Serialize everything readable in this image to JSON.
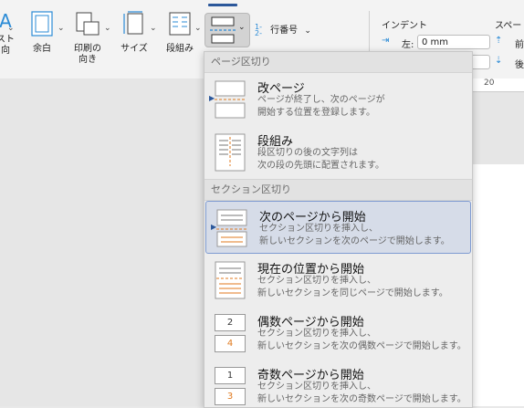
{
  "ribbon": {
    "text_direction_label_line1": "スト",
    "text_direction_label_line2": "向",
    "margins_label": "余白",
    "orientation_label_line1": "印刷の",
    "orientation_label_line2": "向き",
    "size_label": "サイズ",
    "columns_label": "段組み",
    "line_numbers_label": "行番号",
    "indent_header": "インデント",
    "spacing_header": "スペー",
    "indent_left_label": "左:",
    "indent_left_value": "0 mm",
    "spacing_before_label": "前",
    "spacing_after_label": "後",
    "ruler_mark": "20"
  },
  "menu": {
    "page_break_header": "ページ区切り",
    "section_break_header": "セクション区切り",
    "page_break_items": [
      {
        "title": "改ページ",
        "desc": "ページが終了し、次のページが\n開始する位置を登録します。"
      },
      {
        "title": "段組み",
        "desc": "段区切りの後の文字列は\n次の段の先頭に配置されます。"
      }
    ],
    "section_items": [
      {
        "title": "次のページから開始",
        "desc": "セクション区切りを挿入し、\n新しいセクションを次のページで開始します。"
      },
      {
        "title": "現在の位置から開始",
        "desc": "セクション区切りを挿入し、\n新しいセクションを同じページで開始します。"
      },
      {
        "title": "偶数ページから開始",
        "desc": "セクション区切りを挿入し、\n新しいセクションを次の偶数ページで開始します。",
        "badge_top": "2",
        "badge_bottom": "4"
      },
      {
        "title": "奇数ページから開始",
        "desc": "セクション区切りを挿入し、\n新しいセクションを次の奇数ページで開始します。",
        "badge_top": "1",
        "badge_bottom": "3"
      }
    ]
  },
  "colors": {
    "accent": "#2b579a",
    "selected_bg": "#d6dce8",
    "selected_border": "#7f9bd1"
  }
}
